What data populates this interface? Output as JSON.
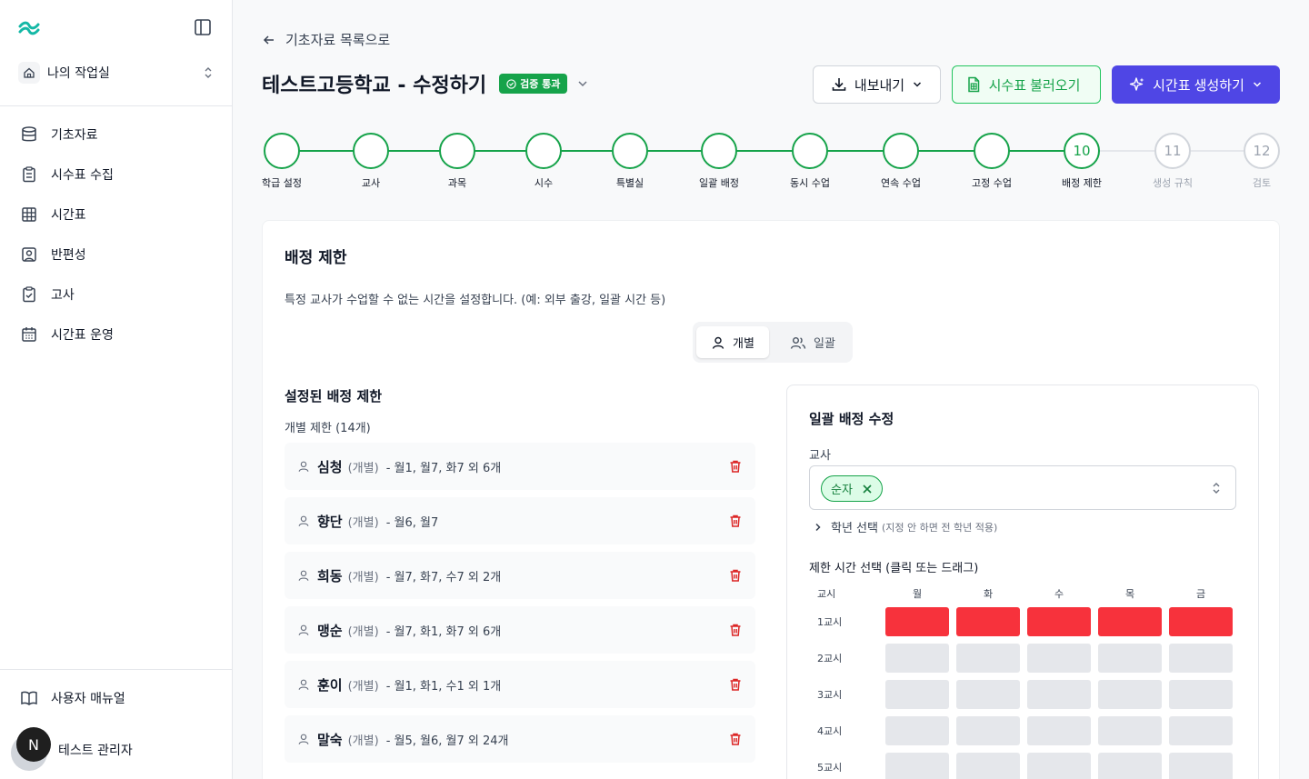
{
  "sidebar": {
    "workspace": "나의 작업실",
    "items": [
      {
        "label": "기초자료",
        "icon": "database-icon"
      },
      {
        "label": "시수표 수집",
        "icon": "clipboard-list-icon"
      },
      {
        "label": "시간표",
        "icon": "grid-icon"
      },
      {
        "label": "반편성",
        "icon": "user-square-icon"
      },
      {
        "label": "고사",
        "icon": "clipboard-check-icon"
      },
      {
        "label": "시간표 운영",
        "icon": "calendar-icon"
      }
    ],
    "manual": "사용자 매뉴얼",
    "user_name": "테스트 관리자",
    "user_initial": "N"
  },
  "header": {
    "back_label": "기초자료 목록으로",
    "title": "테스트고등학교 - 수정하기",
    "badge": "검증 통과",
    "export_label": "내보내기",
    "import_label": "시수표 불러오기",
    "generate_label": "시간표 생성하기"
  },
  "steps": [
    {
      "label": "학급 설정",
      "number": "",
      "state": "done"
    },
    {
      "label": "교사",
      "number": "",
      "state": "done"
    },
    {
      "label": "과목",
      "number": "",
      "state": "done"
    },
    {
      "label": "시수",
      "number": "",
      "state": "done"
    },
    {
      "label": "특별실",
      "number": "",
      "state": "done"
    },
    {
      "label": "일괄 배정",
      "number": "",
      "state": "done"
    },
    {
      "label": "동시 수업",
      "number": "",
      "state": "done"
    },
    {
      "label": "연속 수업",
      "number": "",
      "state": "done"
    },
    {
      "label": "고정 수업",
      "number": "",
      "state": "done"
    },
    {
      "label": "배정 제한",
      "number": "10",
      "state": "current"
    },
    {
      "label": "생성 규칙",
      "number": "11",
      "state": "pending"
    },
    {
      "label": "검토",
      "number": "12",
      "state": "pending"
    }
  ],
  "card": {
    "title": "배정 제한",
    "description": "특정 교사가 수업할 수 없는 시간을 설정합니다. (예: 외부 출강, 일괄 시간 등)",
    "toggle": {
      "individual": "개별",
      "bulk": "일괄"
    },
    "list_title": "설정된 배정 제한",
    "list_subtitle": "개별 제한 (14개)",
    "restrictions": [
      {
        "name": "심청",
        "type": "(개별)",
        "slots": "- 월1, 월7, 화7 외 6개"
      },
      {
        "name": "향단",
        "type": "(개별)",
        "slots": "- 월6, 월7"
      },
      {
        "name": "희동",
        "type": "(개별)",
        "slots": "- 월7, 화7, 수7 외 2개"
      },
      {
        "name": "맹순",
        "type": "(개별)",
        "slots": "- 월7, 화1, 화7 외 6개"
      },
      {
        "name": "훈이",
        "type": "(개별)",
        "slots": "- 월1, 화1, 수1 외 1개"
      },
      {
        "name": "말숙",
        "type": "(개별)",
        "slots": "- 월5, 월6, 월7 외 24개"
      }
    ]
  },
  "panel": {
    "title": "일괄 배정 수정",
    "teacher_label": "교사",
    "selected_teacher": "순자",
    "grade_label": "학년 선택",
    "grade_hint": "(지정 안 하면 전 학년 적용)",
    "time_label": "제한 시간 선택 (클릭 또는 드래그)",
    "grid": {
      "period_header": "교시",
      "days": [
        "월",
        "화",
        "수",
        "목",
        "금"
      ],
      "periods": [
        "1교시",
        "2교시",
        "3교시",
        "4교시",
        "5교시"
      ],
      "selected": [
        [
          true,
          true,
          true,
          true,
          true
        ],
        [
          false,
          false,
          false,
          false,
          false
        ],
        [
          false,
          false,
          false,
          false,
          false
        ],
        [
          false,
          false,
          false,
          false,
          false
        ],
        [
          false,
          false,
          false,
          false,
          false
        ]
      ]
    }
  },
  "colors": {
    "accent": "#4f46e5",
    "success": "#16a34a",
    "danger": "#dc2626",
    "selected_cell": "#f7323c"
  }
}
